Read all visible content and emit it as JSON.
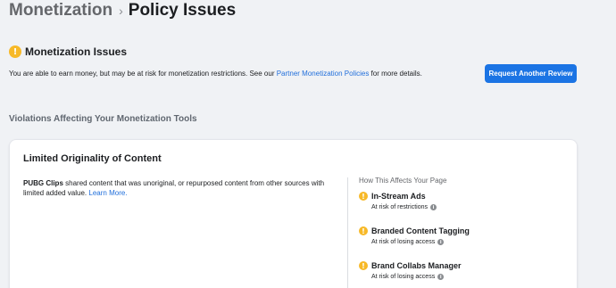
{
  "breadcrumb": {
    "parent": "Monetization",
    "separator": "›",
    "current": "Policy Issues"
  },
  "issues": {
    "title": "Monetization Issues",
    "description_prefix": "You are able to earn money, but may be at risk for monetization restrictions. See our ",
    "link_text": "Partner Monetization Policies",
    "description_suffix": " for more details.",
    "button_label": "Request Another Review"
  },
  "violations": {
    "section_title": "Violations Affecting Your Monetization Tools",
    "card": {
      "title": "Limited Originality of Content",
      "page_name": "PUBG Clips",
      "description": " shared content that was unoriginal, or repurposed content from other sources with limited added value. ",
      "learn_more": "Learn More.",
      "affects_heading": "How This Affects Your Page",
      "tools": [
        {
          "name": "In-Stream Ads",
          "status": "At risk of restrictions"
        },
        {
          "name": "Branded Content Tagging",
          "status": "At risk of losing access"
        },
        {
          "name": "Brand Collabs Manager",
          "status": "At risk of losing access"
        }
      ]
    }
  },
  "icons": {
    "warning": "!",
    "info": "i"
  },
  "colors": {
    "warning": "#f7b928",
    "accent": "#1b74e4",
    "link": "#216fdb",
    "background": "#f0f2f5"
  }
}
